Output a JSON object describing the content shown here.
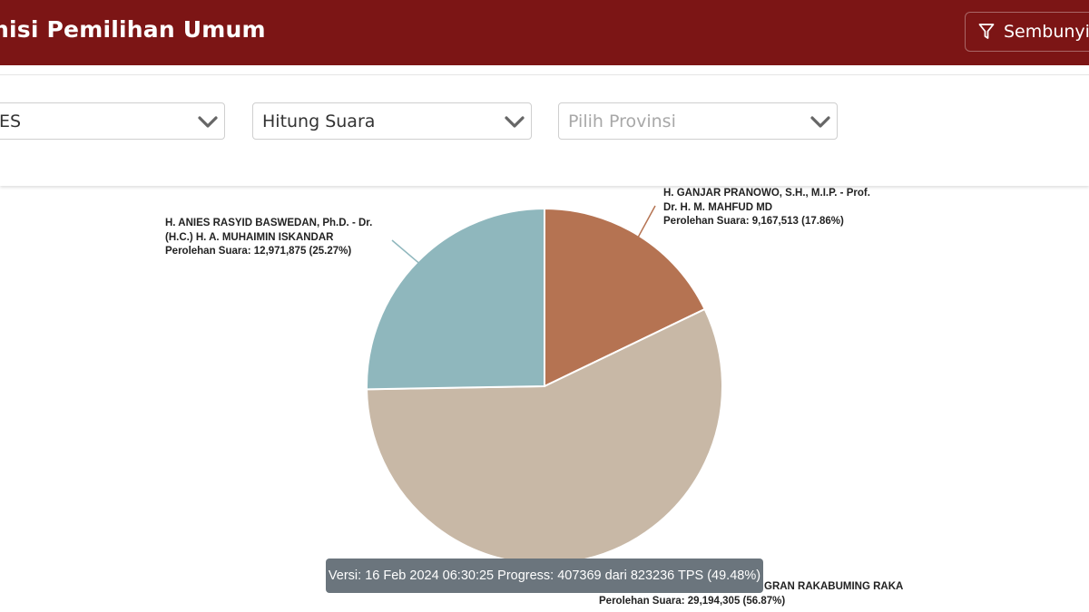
{
  "header": {
    "title": "nisi Pemilihan Umum",
    "hide_filter_label": "Sembunyik"
  },
  "filters": [
    {
      "value": "ES",
      "placeholder": false
    },
    {
      "value": "Hitung Suara",
      "placeholder": false
    },
    {
      "value": "Pilih Provinsi",
      "placeholder": true
    }
  ],
  "colors": {
    "header_bg": "#7c1515",
    "slice_ganjar": "#b57352",
    "slice_prabowo": "#c8b8a6",
    "slice_anies": "#8fb7bd",
    "banner_bg": "#6b757d"
  },
  "chart_data": {
    "type": "pie",
    "slices": [
      {
        "name_lines": [
          "H. GANJAR PRANOWO, S.H., M.I.P. - Prof.",
          "Dr. H. M. MAHFUD MD"
        ],
        "votes_line": "Perolehan Suara: 9,167,513 (17.86%)",
        "value": 9167513,
        "percent": 17.86,
        "color": "#b57352"
      },
      {
        "name_lines": [
          "GRAN RAKABUMING RAKA"
        ],
        "votes_line": "Perolehan Suara: 29,194,305 (56.87%)",
        "value": 29194305,
        "percent": 56.87,
        "color": "#c8b8a6"
      },
      {
        "name_lines": [
          "H. ANIES RASYID BASWEDAN, Ph.D. - Dr.",
          "(H.C.) H. A. MUHAIMIN ISKANDAR"
        ],
        "votes_line": "Perolehan Suara: 12,971,875 (25.27%)",
        "value": 12971875,
        "percent": 25.27,
        "color": "#8fb7bd"
      }
    ]
  },
  "banner": {
    "text": "Versi: 16 Feb 2024 06:30:25 Progress: 407369 dari 823236 TPS (49.48%)"
  }
}
